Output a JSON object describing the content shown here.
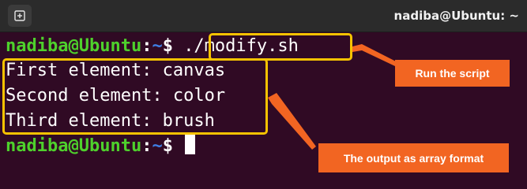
{
  "window": {
    "title": "nadiba@Ubuntu: ~",
    "new_tab_icon": "new-tab-icon"
  },
  "terminal": {
    "prompt": {
      "user_host": "nadiba@Ubuntu",
      "sep": ":",
      "path": "~",
      "dollar": "$"
    },
    "command": "./modify.sh",
    "output": [
      "First element: canvas",
      "Second element: color",
      "Third element: brush"
    ]
  },
  "annotations": {
    "callout_run": "Run the script",
    "callout_output": "The output as array format"
  },
  "colors": {
    "background": "#300a24",
    "prompt_user": "#4ed12c",
    "prompt_path": "#3f7fe6",
    "highlight": "#f7c300",
    "callout": "#f26522"
  }
}
